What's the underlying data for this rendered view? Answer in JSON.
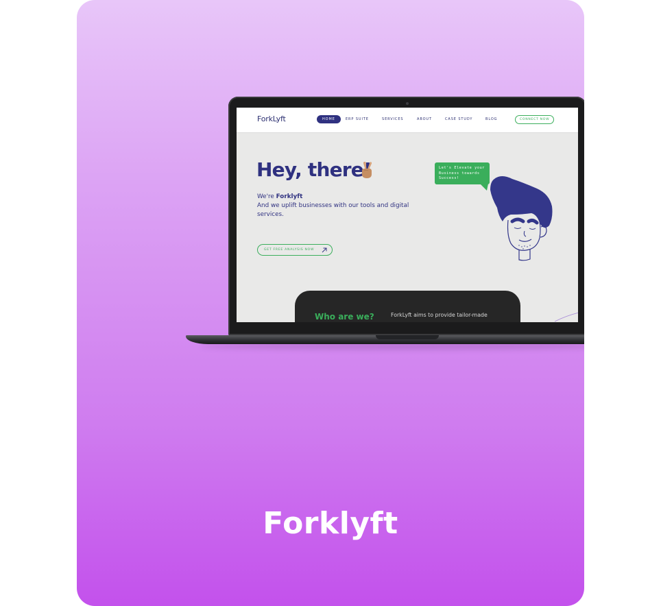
{
  "card": {
    "title": "Forklyft"
  },
  "site": {
    "logo": "ForkLyft",
    "nav": [
      {
        "label": "HOME",
        "active": true
      },
      {
        "label": "ERP SUITE",
        "active": false
      },
      {
        "label": "SERVICES",
        "active": false
      },
      {
        "label": "ABOUT",
        "active": false
      },
      {
        "label": "CASE STUDY",
        "active": false
      },
      {
        "label": "BLOG",
        "active": false
      }
    ],
    "connect_label": "CONNECT NOW",
    "hero": {
      "title": "Hey, there!",
      "intro_prefix": "We're ",
      "brand": "Forklyft",
      "tagline": "And we uplift businesses with our tools and digital services.",
      "cta_label": "GET FREE ANALYSIS NOW",
      "bubble_text": "Let's Elevate your Business towards Success!"
    },
    "about": {
      "title": "Who are we?",
      "text": "ForkLyft aims to provide tailor-made"
    }
  },
  "colors": {
    "brand_navy": "#2f3180",
    "brand_green": "#3aae5b",
    "card_gradient_top": "#e8c6f9",
    "card_gradient_bottom": "#c351ec"
  }
}
